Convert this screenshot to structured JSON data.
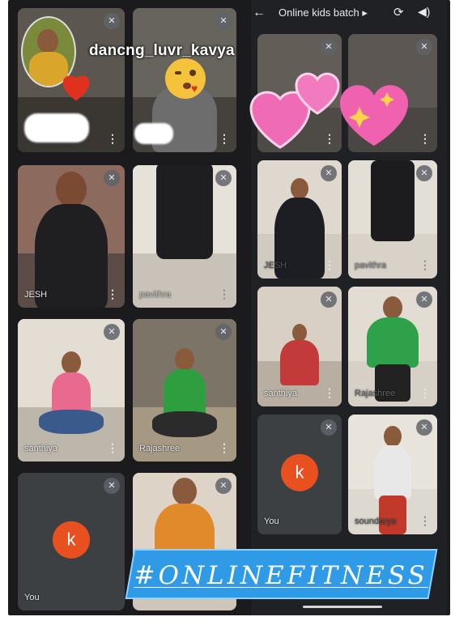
{
  "header": {
    "back_icon": "arrow-left-icon",
    "title": "Online kids batch",
    "title_suffix": "▸",
    "camera_icon": "switch-camera-icon",
    "speaker_icon": "speaker-icon"
  },
  "overlay": {
    "username": "dancng_luvr_kavya",
    "hashtag": "#ONLINEFITNESS"
  },
  "left_grid": {
    "tiles": [
      {
        "name": ""
      },
      {
        "name": ""
      },
      {
        "name": "JESH"
      },
      {
        "name": "pavithra"
      },
      {
        "name": "santhiya"
      },
      {
        "name": "Rajashree"
      },
      {
        "name": "You",
        "avatar_letter": "k"
      },
      {
        "name": ""
      }
    ]
  },
  "right_grid": {
    "tiles": [
      {
        "name": ""
      },
      {
        "name": ""
      },
      {
        "name": "JESH"
      },
      {
        "name": "pavithra"
      },
      {
        "name": "santhiya"
      },
      {
        "name": "Rajashree"
      },
      {
        "name": "You",
        "avatar_letter": "k"
      },
      {
        "name": "soundarya"
      }
    ]
  },
  "colors": {
    "call_background": "#202124",
    "tile_background": "#3c4043",
    "avatar": "#e8501f",
    "hashtag_banner": "#2f9ae6"
  }
}
